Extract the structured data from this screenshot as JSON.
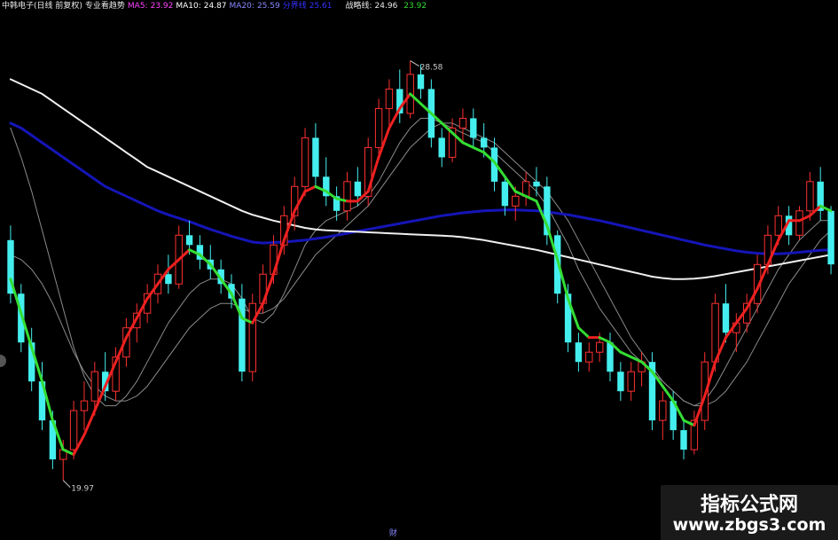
{
  "header": {
    "title": "中韩电子(日线 前复权)",
    "indicator": "专业看趋势",
    "ma5_label": "MA5:",
    "ma5_value": "23.92",
    "ma10_label": "MA10:",
    "ma10_value": "24.87",
    "ma20_label": "MA20:",
    "ma20_value": "25.59",
    "extra_label": "分界线",
    "extra_value": "25.61",
    "war_label": "战略线:",
    "war_value": "24.96",
    "last_value": "23.92"
  },
  "colors": {
    "up": "#ff3030",
    "down": "#44eeee",
    "white_ma": "#f0f0f0",
    "blue_ma": "#1515b8",
    "thin_ma": "#8a8a8a",
    "trend_up": "#ee2020",
    "trend_down": "#33dd33"
  },
  "watermark": {
    "line1": "指标公式网",
    "line2": "www.zbgs3.com"
  },
  "bottom_marker": "财",
  "chart_data": {
    "type": "candlestick",
    "high_label": "28.58",
    "low_label": "19.97",
    "y_range": [
      19.0,
      29.5
    ],
    "candles": [
      [
        24.9,
        25.2,
        23.6,
        23.8
      ],
      [
        23.8,
        24.0,
        22.6,
        22.8
      ],
      [
        22.8,
        23.1,
        21.8,
        22.0
      ],
      [
        22.0,
        22.4,
        21.0,
        21.2
      ],
      [
        21.2,
        21.4,
        20.2,
        20.4
      ],
      [
        20.4,
        20.8,
        19.97,
        20.6
      ],
      [
        20.6,
        21.6,
        20.4,
        21.4
      ],
      [
        21.4,
        22.0,
        21.0,
        21.6
      ],
      [
        21.6,
        22.4,
        21.3,
        22.2
      ],
      [
        22.2,
        22.6,
        21.6,
        21.8
      ],
      [
        21.8,
        22.7,
        21.6,
        22.5
      ],
      [
        22.5,
        23.3,
        22.3,
        23.1
      ],
      [
        23.1,
        23.6,
        22.8,
        23.4
      ],
      [
        23.4,
        24.0,
        23.2,
        23.8
      ],
      [
        23.8,
        24.4,
        23.6,
        24.2
      ],
      [
        24.2,
        24.6,
        23.8,
        24.0
      ],
      [
        24.0,
        25.2,
        23.9,
        25.0
      ],
      [
        25.0,
        25.3,
        24.6,
        24.8
      ],
      [
        24.8,
        25.0,
        24.3,
        24.5
      ],
      [
        24.5,
        24.8,
        24.1,
        24.3
      ],
      [
        24.3,
        24.5,
        23.8,
        24.0
      ],
      [
        24.0,
        24.2,
        23.5,
        23.7
      ],
      [
        23.7,
        24.0,
        22.0,
        22.2
      ],
      [
        22.2,
        23.8,
        22.0,
        23.6
      ],
      [
        23.6,
        24.4,
        23.4,
        24.2
      ],
      [
        24.2,
        25.0,
        24.0,
        24.8
      ],
      [
        24.8,
        25.6,
        24.6,
        25.4
      ],
      [
        25.4,
        26.2,
        25.1,
        26.0
      ],
      [
        26.0,
        27.2,
        25.8,
        27.0
      ],
      [
        27.0,
        27.3,
        26.0,
        26.2
      ],
      [
        26.2,
        26.6,
        25.6,
        25.8
      ],
      [
        25.8,
        26.0,
        25.3,
        25.5
      ],
      [
        25.5,
        26.3,
        25.3,
        26.1
      ],
      [
        26.1,
        26.4,
        25.6,
        25.8
      ],
      [
        25.8,
        27.0,
        25.6,
        26.8
      ],
      [
        26.8,
        27.8,
        26.6,
        27.6
      ],
      [
        27.6,
        28.2,
        27.2,
        28.0
      ],
      [
        28.0,
        28.4,
        27.3,
        27.5
      ],
      [
        27.5,
        28.58,
        27.4,
        28.3
      ],
      [
        28.3,
        28.5,
        27.8,
        28.0
      ],
      [
        28.0,
        28.2,
        26.8,
        27.0
      ],
      [
        27.0,
        27.2,
        26.4,
        26.6
      ],
      [
        26.6,
        27.4,
        26.5,
        27.2
      ],
      [
        27.2,
        27.6,
        26.9,
        27.4
      ],
      [
        27.4,
        27.6,
        26.8,
        27.0
      ],
      [
        27.0,
        27.3,
        26.6,
        26.8
      ],
      [
        26.8,
        27.0,
        25.9,
        26.1
      ],
      [
        26.1,
        26.2,
        25.4,
        25.6
      ],
      [
        25.6,
        26.0,
        25.3,
        25.8
      ],
      [
        25.8,
        26.3,
        25.6,
        26.1
      ],
      [
        26.1,
        26.4,
        25.8,
        26.0
      ],
      [
        26.0,
        26.2,
        24.8,
        25.0
      ],
      [
        25.0,
        25.1,
        23.6,
        23.8
      ],
      [
        23.8,
        24.0,
        22.6,
        22.8
      ],
      [
        22.8,
        23.0,
        22.2,
        22.4
      ],
      [
        22.4,
        22.8,
        22.2,
        22.6
      ],
      [
        22.6,
        23.0,
        22.4,
        22.8
      ],
      [
        22.8,
        23.0,
        22.0,
        22.2
      ],
      [
        22.2,
        22.4,
        21.6,
        21.8
      ],
      [
        21.8,
        22.4,
        21.6,
        22.2
      ],
      [
        22.2,
        22.6,
        21.9,
        22.4
      ],
      [
        22.4,
        22.6,
        21.0,
        21.2
      ],
      [
        21.2,
        21.8,
        20.8,
        21.6
      ],
      [
        21.6,
        21.8,
        20.8,
        21.0
      ],
      [
        21.0,
        21.2,
        20.4,
        20.6
      ],
      [
        20.6,
        21.4,
        20.5,
        21.2
      ],
      [
        21.2,
        22.6,
        21.0,
        22.4
      ],
      [
        22.4,
        23.8,
        22.2,
        23.6
      ],
      [
        23.6,
        24.0,
        22.8,
        23.0
      ],
      [
        23.0,
        23.4,
        22.6,
        23.2
      ],
      [
        23.2,
        23.8,
        23.0,
        23.6
      ],
      [
        23.6,
        24.6,
        23.4,
        24.4
      ],
      [
        24.4,
        25.2,
        24.2,
        25.0
      ],
      [
        25.0,
        25.6,
        24.8,
        25.4
      ],
      [
        25.4,
        25.6,
        24.8,
        25.0
      ],
      [
        25.0,
        25.6,
        24.9,
        25.5
      ],
      [
        25.5,
        26.3,
        25.3,
        26.1
      ],
      [
        26.1,
        26.4,
        25.3,
        25.5
      ],
      [
        25.5,
        25.6,
        24.2,
        24.4
      ]
    ],
    "ma_long_white": [
      28.2,
      28.1,
      28.0,
      27.9,
      27.75,
      27.6,
      27.45,
      27.3,
      27.15,
      27.0,
      26.85,
      26.7,
      26.55,
      26.4,
      26.3,
      26.2,
      26.1,
      26.0,
      25.9,
      25.8,
      25.7,
      25.6,
      25.5,
      25.42,
      25.36,
      25.3,
      25.25,
      25.2,
      25.15,
      25.12,
      25.1,
      25.09,
      25.08,
      25.07,
      25.06,
      25.05,
      25.04,
      25.03,
      25.02,
      25.01,
      25.0,
      24.99,
      24.98,
      24.96,
      24.93,
      24.9,
      24.86,
      24.82,
      24.78,
      24.74,
      24.7,
      24.65,
      24.6,
      24.55,
      24.5,
      24.45,
      24.4,
      24.35,
      24.3,
      24.25,
      24.2,
      24.15,
      24.12,
      24.1,
      24.1,
      24.11,
      24.13,
      24.16,
      24.2,
      24.24,
      24.28,
      24.32,
      24.36,
      24.4,
      24.44,
      24.48,
      24.52,
      24.56,
      24.6
    ],
    "ma_long_blue": [
      27.3,
      27.2,
      27.05,
      26.9,
      26.75,
      26.6,
      26.45,
      26.3,
      26.15,
      26.0,
      25.9,
      25.8,
      25.7,
      25.6,
      25.5,
      25.42,
      25.35,
      25.28,
      25.2,
      25.12,
      25.05,
      24.98,
      24.92,
      24.86,
      24.84,
      24.85,
      24.86,
      24.88,
      24.9,
      24.93,
      24.96,
      25.0,
      25.04,
      25.08,
      25.12,
      25.16,
      25.2,
      25.24,
      25.28,
      25.32,
      25.36,
      25.4,
      25.43,
      25.46,
      25.48,
      25.5,
      25.51,
      25.52,
      25.52,
      25.51,
      25.5,
      25.48,
      25.45,
      25.42,
      25.38,
      25.34,
      25.3,
      25.25,
      25.2,
      25.15,
      25.1,
      25.05,
      25.0,
      24.95,
      24.9,
      24.85,
      24.8,
      24.76,
      24.72,
      24.68,
      24.65,
      24.63,
      24.62,
      24.62,
      24.63,
      24.65,
      24.67,
      24.69,
      24.7
    ],
    "trend_line": [
      24.1,
      23.4,
      22.7,
      22.0,
      21.2,
      20.6,
      20.5,
      20.9,
      21.4,
      21.9,
      22.4,
      22.9,
      23.3,
      23.7,
      24.0,
      24.3,
      24.5,
      24.7,
      24.6,
      24.4,
      24.1,
      23.8,
      23.3,
      23.2,
      23.6,
      24.2,
      24.9,
      25.5,
      25.9,
      26.0,
      25.9,
      25.75,
      25.7,
      25.7,
      25.9,
      26.6,
      27.2,
      27.6,
      27.9,
      27.7,
      27.5,
      27.3,
      27.1,
      26.9,
      26.8,
      26.7,
      26.5,
      26.2,
      25.9,
      25.8,
      25.7,
      25.2,
      24.5,
      23.7,
      23.1,
      22.9,
      22.9,
      22.8,
      22.6,
      22.5,
      22.4,
      22.2,
      21.9,
      21.6,
      21.2,
      21.1,
      21.7,
      22.4,
      22.9,
      23.2,
      23.5,
      23.9,
      24.4,
      24.9,
      25.3,
      25.3,
      25.4,
      25.6,
      25.5
    ],
    "ma_thin1": [
      27.2,
      26.6,
      25.9,
      25.1,
      24.3,
      23.5,
      22.7,
      22.1,
      21.7,
      21.5,
      21.5,
      21.7,
      22.0,
      22.4,
      22.8,
      23.2,
      23.5,
      23.8,
      24.0,
      24.1,
      24.1,
      24.0,
      23.7,
      23.3,
      23.2,
      23.4,
      23.8,
      24.3,
      24.8,
      25.1,
      25.3,
      25.4,
      25.5,
      25.6,
      25.8,
      26.1,
      26.5,
      26.9,
      27.2,
      27.4,
      27.4,
      27.3,
      27.2,
      27.1,
      27.0,
      26.9,
      26.7,
      26.5,
      26.3,
      26.1,
      25.9,
      25.6,
      25.2,
      24.8,
      24.3,
      23.9,
      23.5,
      23.2,
      22.9,
      22.6,
      22.4,
      22.2,
      22.0,
      21.8,
      21.6,
      21.5,
      21.6,
      21.9,
      22.3,
      22.7,
      23.1,
      23.5,
      23.9,
      24.3,
      24.6,
      24.9,
      25.1,
      25.3,
      25.3
    ],
    "ma_thin2": [
      24.6,
      24.5,
      24.3,
      24.0,
      23.6,
      23.1,
      22.6,
      22.2,
      21.9,
      21.7,
      21.6,
      21.6,
      21.7,
      21.9,
      22.2,
      22.5,
      22.8,
      23.1,
      23.3,
      23.5,
      23.6,
      23.6,
      23.5,
      23.4,
      23.4,
      23.5,
      23.7,
      24.0,
      24.3,
      24.6,
      24.8,
      25.0,
      25.2,
      25.4,
      25.6,
      25.9,
      26.2,
      26.5,
      26.8,
      27.0,
      27.2,
      27.3,
      27.3,
      27.2,
      27.1,
      27.0,
      26.9,
      26.7,
      26.5,
      26.3,
      26.1,
      25.9,
      25.6,
      25.3,
      24.9,
      24.5,
      24.1,
      23.7,
      23.3,
      22.9,
      22.6,
      22.3,
      22.0,
      21.8,
      21.6,
      21.5,
      21.5,
      21.6,
      21.8,
      22.1,
      22.4,
      22.8,
      23.2,
      23.6,
      24.0,
      24.3,
      24.6,
      24.9,
      25.1
    ]
  }
}
